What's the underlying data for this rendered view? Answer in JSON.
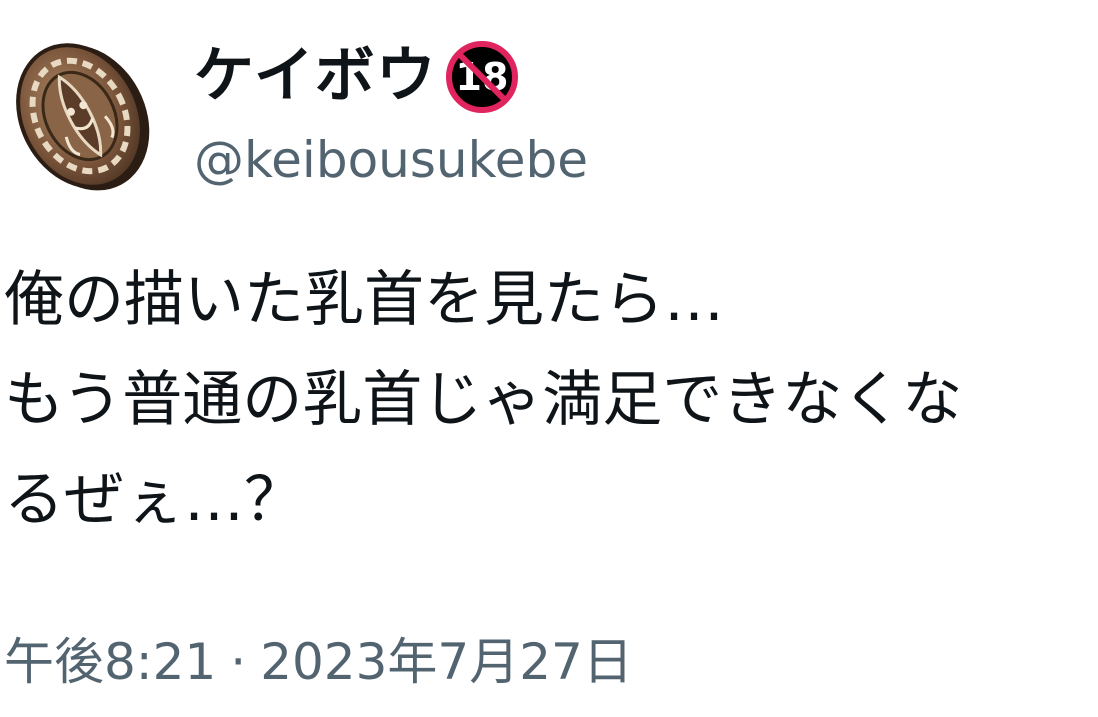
{
  "tweet": {
    "author": {
      "display_name": "ケイボウ",
      "badge_text": "18",
      "handle": "@keibousukebe",
      "avatar_icon": "bronze-coin-avatar",
      "badge_icon": "no-under-18-icon"
    },
    "text_lines": [
      "俺の描いた乳首を見たら…",
      "もう普通の乳首じゃ満足できなくな",
      "るぜぇ…？"
    ],
    "time": "午後8:21",
    "separator": "·",
    "date": "2023年7月27日"
  },
  "colors": {
    "text_primary": "#0f1419",
    "text_secondary": "#536471",
    "badge_ring": "#e0245e",
    "badge_fill": "#000000"
  }
}
